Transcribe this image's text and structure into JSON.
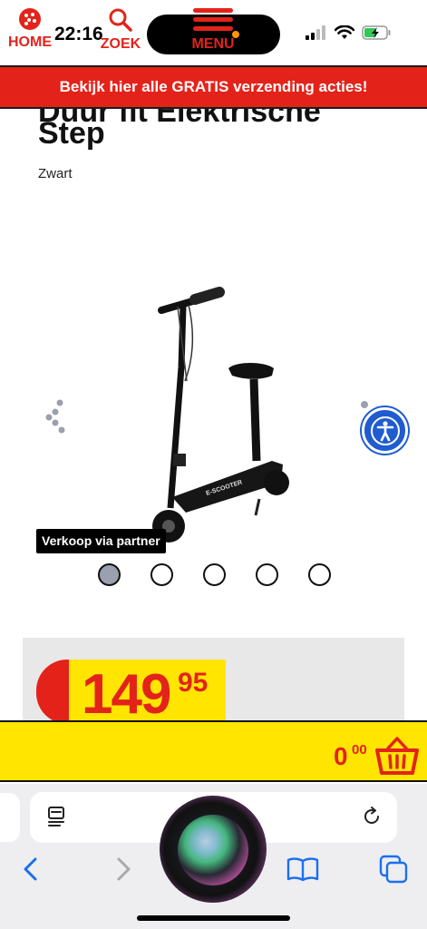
{
  "status_bar": {
    "time": "22:16"
  },
  "promo_banner": {
    "text": "Bekijk hier alle GRATIS verzending acties!"
  },
  "product": {
    "title_partial": "Step",
    "title_cut": "Duur fit Elektrische",
    "subtitle": "Zwart",
    "partner_badge": "Verkoop via partner",
    "carousel_dots": 5,
    "carousel_active_index": 0,
    "scooter_deck_label": "E-SCOOTER"
  },
  "price": {
    "main": "149",
    "cents": "95"
  },
  "bottom_nav": {
    "home_label": "HOME",
    "zoek_label": "ZOEK",
    "menu_label": "MENU",
    "cart_amount": "0",
    "cart_cents": "00"
  },
  "colors": {
    "brand_red": "#e3231a",
    "brand_yellow": "#ffe500",
    "accessibility_blue": "#1f5ccf"
  },
  "icons": {
    "share": "share-icon",
    "accessibility": "accessibility-icon",
    "home": "home-icon",
    "search": "search-icon",
    "menu": "menu-icon",
    "cart": "cart-icon",
    "reader": "reader-icon",
    "reload": "reload-icon",
    "back": "back-icon",
    "forward": "forward-icon",
    "bookmarks": "bookmarks-icon",
    "tabs": "tabs-icon"
  }
}
